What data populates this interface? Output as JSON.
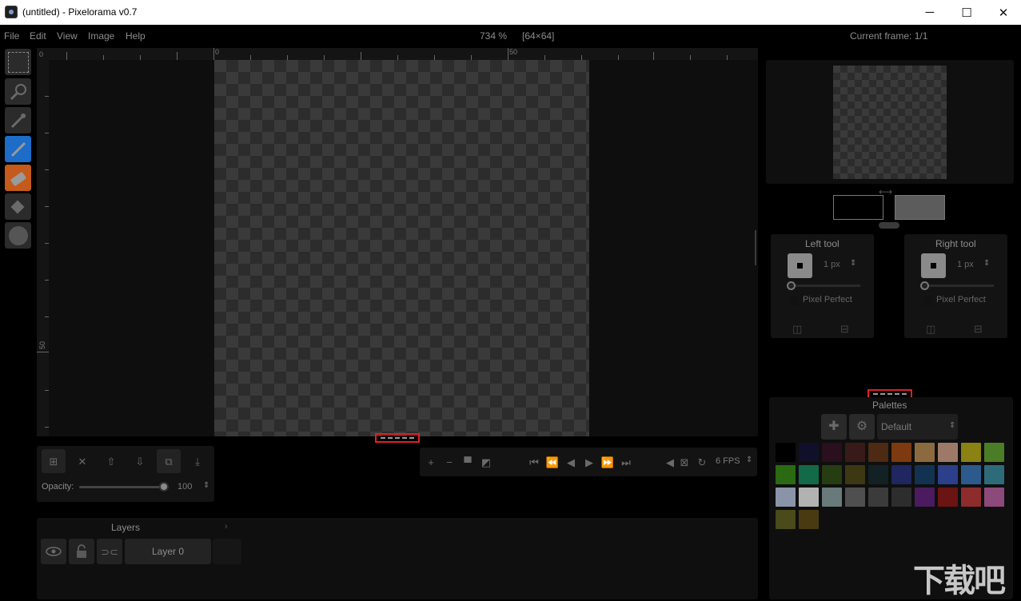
{
  "window": {
    "title": "(untitled) - Pixelorama v0.7",
    "minimize": "─",
    "maximize": "☐",
    "close": "✕"
  },
  "menu": {
    "items": [
      "File",
      "Edit",
      "View",
      "Image",
      "Help"
    ]
  },
  "canvas_info": {
    "zoom": "734 %",
    "size": "[64×64]"
  },
  "frame_info": {
    "label": "Current frame: 1/1"
  },
  "ruler": {
    "top_labels": [
      "0",
      "0",
      "50"
    ],
    "left_labels": [
      "0",
      "50"
    ]
  },
  "left_tool": {
    "label": "Left tool",
    "brush_size": "1 px",
    "pixel_perfect": "Pixel Perfect"
  },
  "right_tool": {
    "label": "Right tool",
    "brush_size": "1 px",
    "pixel_perfect": "Pixel Perfect"
  },
  "layer_controls": {
    "opacity_label": "Opacity:",
    "opacity_value": "100"
  },
  "animation": {
    "fps": "6 FPS"
  },
  "layers": {
    "title": "Layers",
    "collapse": "›",
    "items": [
      {
        "name": "Layer 0"
      }
    ]
  },
  "palettes": {
    "title": "Palettes",
    "selected": "Default",
    "colors": [
      "#000000",
      "#10102a",
      "#2a0f1f",
      "#381b18",
      "#4c2a14",
      "#7d3a10",
      "#8c6a3f",
      "#9d7a67",
      "#8a8212",
      "#4a7d26",
      "#2a6a12",
      "#126a49",
      "#263d12",
      "#3d3712",
      "#122224",
      "#1f2660",
      "#123252",
      "#2c3f8a",
      "#2c5a8c",
      "#2e6b7a",
      "#8a94a8",
      "#b2b2b2",
      "#687a7a",
      "#4f4f4f",
      "#3b3b3b",
      "#2c2d2c",
      "#4a1b5e",
      "#6a1414",
      "#8c2c2c",
      "#8c4a7a",
      "#4a4a1a",
      "#4a3a12"
    ]
  },
  "tools": [
    "rectangle-select",
    "zoom",
    "color-picker",
    "pencil",
    "eraser",
    "bucket",
    "lighten-darken"
  ],
  "accent": {
    "pencil": "#1d6cc8",
    "eraser": "#c55a1d",
    "highlight": "#e02020"
  }
}
